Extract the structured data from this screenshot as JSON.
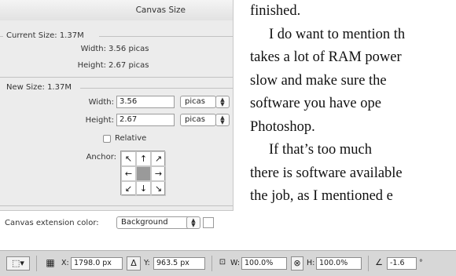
{
  "dialog": {
    "title": "Canvas Size",
    "current_size": {
      "heading": "Current Size: 1.37M",
      "width_label": "Width:",
      "width_value": "3.56 picas",
      "height_label": "Height:",
      "height_value": "2.67 picas"
    },
    "new_size": {
      "heading": "New Size: 1.37M",
      "width_label": "Width:",
      "width_value": "3.56",
      "width_unit": "picas",
      "height_label": "Height:",
      "height_value": "2.67",
      "height_unit": "picas",
      "relative_label": "Relative",
      "relative_checked": false,
      "anchor_label": "Anchor:",
      "anchor_arrows": [
        "↖",
        "↑",
        "↗",
        "←",
        "",
        "→",
        "↙",
        "↓",
        "↘"
      ]
    },
    "extension": {
      "label": "Canvas extension color:",
      "value": "Background",
      "swatch_color": "#ffffff"
    }
  },
  "book_text": {
    "lines": [
      "finished.",
      "I do want to mention th",
      "takes a lot of RAM power",
      "slow and make sure the",
      "software you have ope",
      "Photoshop.",
      "If that’s too much",
      "there is software available",
      "the job, as I mentioned e"
    ]
  },
  "toolbar": {
    "x_label": "X:",
    "x_value": "1798.0 px",
    "delta_icon": "Δ",
    "y_label": "Y:",
    "y_value": "963.5 px",
    "w_label": "W:",
    "w_value": "100.0%",
    "h_label": "H:",
    "h_value": "100.0%",
    "rotate_value": "-1.6",
    "degree": "°"
  }
}
